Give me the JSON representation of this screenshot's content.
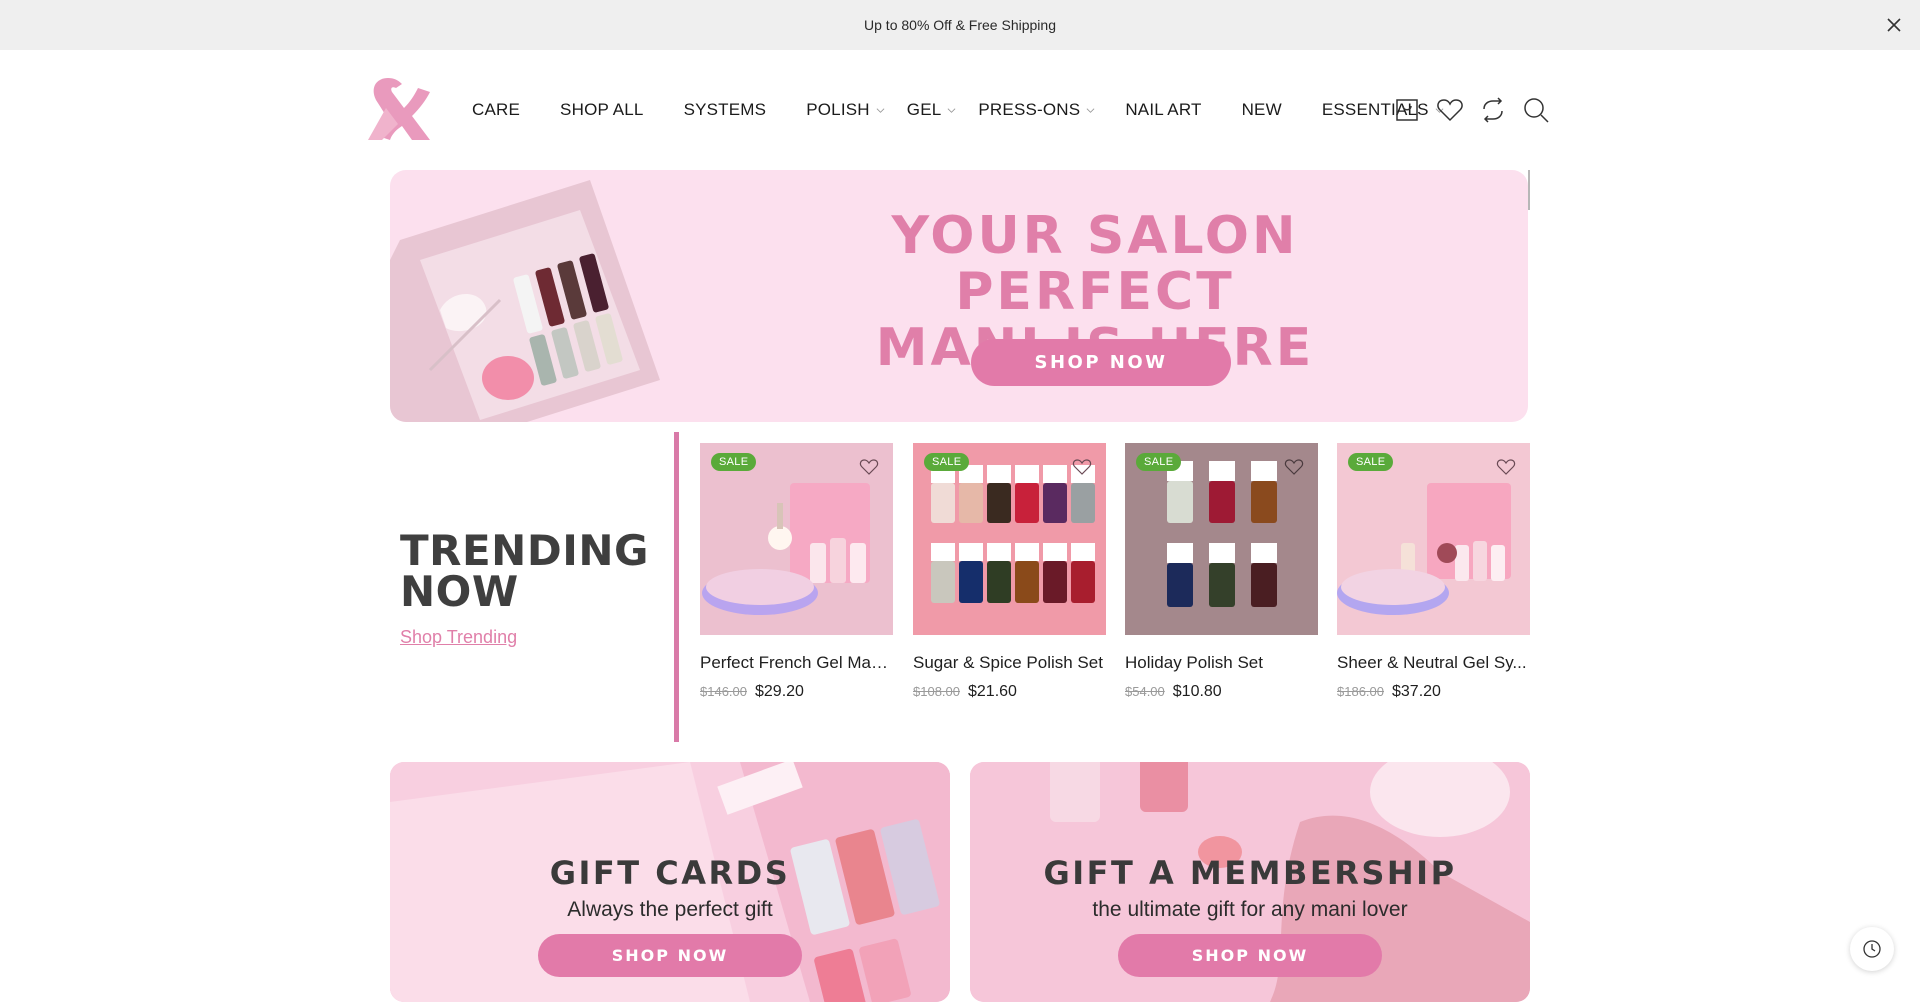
{
  "announcement": {
    "text": "Up to 80% Off & Free Shipping",
    "close_icon": "close-icon"
  },
  "nav": {
    "items": [
      {
        "label": "CARE",
        "dropdown": false
      },
      {
        "label": "SHOP ALL",
        "dropdown": false
      },
      {
        "label": "SYSTEMS",
        "dropdown": false
      },
      {
        "label": "POLISH",
        "dropdown": true
      },
      {
        "label": "GEL",
        "dropdown": true
      },
      {
        "label": "PRESS-ONS",
        "dropdown": true
      },
      {
        "label": "NAIL ART",
        "dropdown": false
      },
      {
        "label": "NEW",
        "dropdown": false
      },
      {
        "label": "ESSENTIALS",
        "dropdown": true
      }
    ],
    "icons": [
      "cart-icon",
      "heart-icon",
      "refresh-icon",
      "search-icon"
    ]
  },
  "hero": {
    "title_line1": "YOUR SALON PERFECT",
    "title_line2": "MANI IS HERE",
    "button": "SHOP NOW"
  },
  "trending": {
    "title_line1": "TRENDING",
    "title_line2": "NOW",
    "link": "Shop Trending",
    "products": [
      {
        "badge": "SALE",
        "name": "Perfect French Gel Man...",
        "old_price": "$146.00",
        "price": "$29.20"
      },
      {
        "badge": "SALE",
        "name": "Sugar & Spice Polish Set",
        "old_price": "$108.00",
        "price": "$21.60"
      },
      {
        "badge": "SALE",
        "name": "Holiday Polish Set",
        "old_price": "$54.00",
        "price": "$10.80"
      },
      {
        "badge": "SALE",
        "name": "Sheer & Neutral Gel Sy...",
        "old_price": "$186.00",
        "price": "$37.20"
      }
    ]
  },
  "promos": [
    {
      "title": "GIFT CARDS",
      "subtitle": "Always the perfect gift",
      "button": "SHOP NOW"
    },
    {
      "title": "GIFT A MEMBERSHIP",
      "subtitle": "the ultimate gift for any mani lover",
      "button": "SHOP NOW"
    }
  ],
  "colors": {
    "accent": "#e27aa9",
    "hero_bg": "#fce0ee",
    "sale_badge": "#5aaa3a",
    "announcement_bg": "#efefef"
  }
}
